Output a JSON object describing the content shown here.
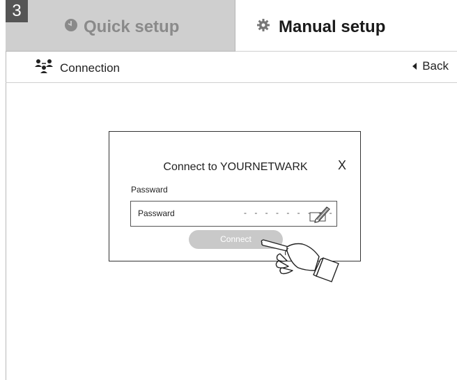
{
  "step": {
    "number": "3"
  },
  "tabs": {
    "quick_setup": {
      "label": "Quick setup",
      "icon": "clock-icon",
      "active": false
    },
    "manual_setup": {
      "label": "Manual setup",
      "icon": "gear-icon",
      "active": true
    }
  },
  "subheader": {
    "title": "Connection",
    "icon": "network-users-icon",
    "back_label": "Back"
  },
  "dialog": {
    "title": "Connect to YOURNETWARK",
    "close_label": "X",
    "password_label": "Passward",
    "password_placeholder": "Passward",
    "password_mask": "- - - - - - - - -",
    "edit_icon": "pencil-edit-icon",
    "connect_label": "Connect"
  },
  "colors": {
    "step_badge": "#555555",
    "inactive_tab": "#cfcfcf",
    "inactive_text": "#8a8a8a",
    "connect_button": "#c9c9c9"
  }
}
